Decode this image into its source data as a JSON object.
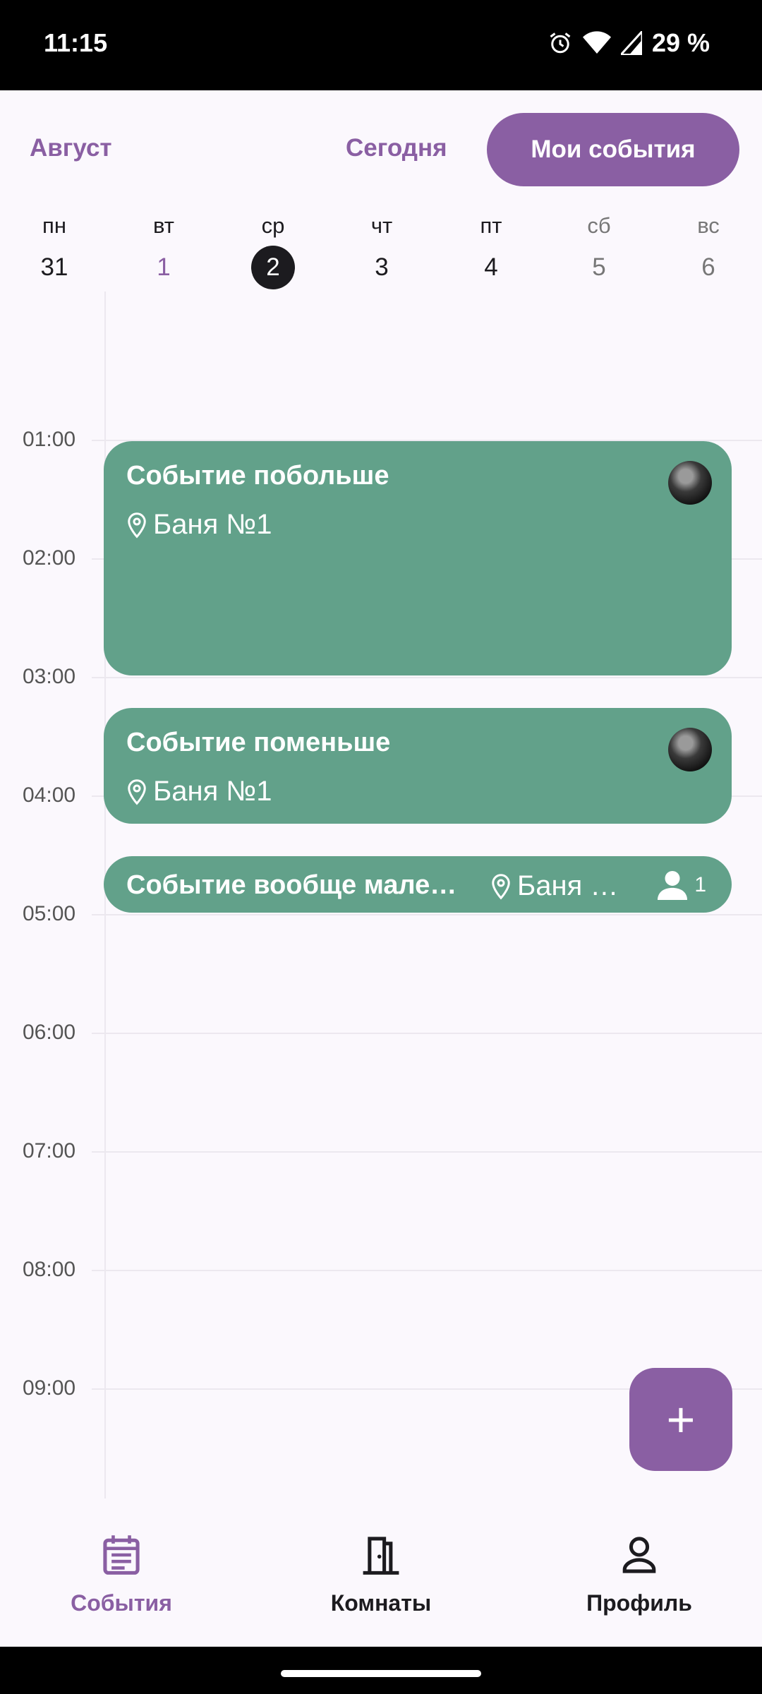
{
  "status_bar": {
    "time": "11:15",
    "battery": "29 %",
    "icons": [
      "alarm-icon",
      "wifi-icon",
      "signal-icon"
    ]
  },
  "header": {
    "month": "Август",
    "today_label": "Сегодня",
    "my_events_label": "Мои события"
  },
  "week": {
    "days": [
      {
        "name": "пн",
        "num": "31"
      },
      {
        "name": "вт",
        "num": "1"
      },
      {
        "name": "ср",
        "num": "2"
      },
      {
        "name": "чт",
        "num": "3"
      },
      {
        "name": "пт",
        "num": "4"
      },
      {
        "name": "сб",
        "num": "5"
      },
      {
        "name": "вс",
        "num": "6"
      }
    ],
    "today_index": 1,
    "selected_index": 2
  },
  "timeline": {
    "hours": [
      "01:00",
      "02:00",
      "03:00",
      "04:00",
      "05:00",
      "06:00",
      "07:00",
      "08:00",
      "09:00"
    ]
  },
  "events": [
    {
      "title": "Событие побольше",
      "location": "Баня №1"
    },
    {
      "title": "Событие поменьше",
      "location": "Баня №1"
    },
    {
      "title": "Событие вообще мале…",
      "location": "Баня …",
      "participants": "1"
    }
  ],
  "fab": {
    "label": "+"
  },
  "bottom_nav": {
    "items": [
      {
        "label": "События",
        "icon": "calendar-icon"
      },
      {
        "label": "Комнаты",
        "icon": "door-icon"
      },
      {
        "label": "Профиль",
        "icon": "person-icon"
      }
    ],
    "active_index": 0
  },
  "colors": {
    "accent": "#8A5FA3",
    "event": "#62A18A",
    "background": "#FBF8FD"
  }
}
